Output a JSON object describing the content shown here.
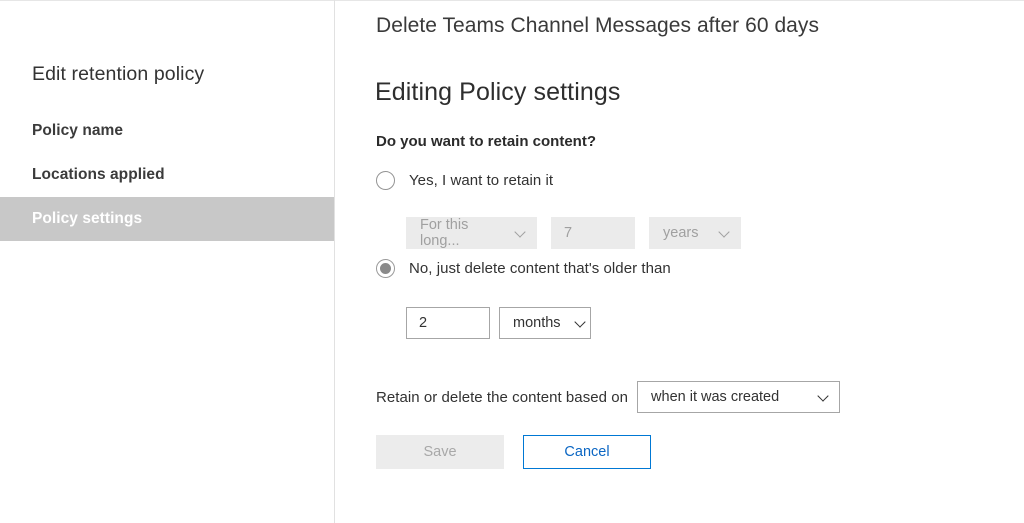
{
  "sidebar": {
    "title": "Edit retention policy",
    "items": [
      {
        "label": "Policy name",
        "selected": false
      },
      {
        "label": "Locations applied",
        "selected": false
      },
      {
        "label": "Policy settings",
        "selected": true
      }
    ]
  },
  "main": {
    "policy_name": "Delete Teams Channel Messages after 60 days",
    "page_title": "Editing Policy settings",
    "question_label": "Do you want to retain content?",
    "options": {
      "retain": {
        "label": "Yes, I want to retain it",
        "selected": false,
        "duration_type": "For this long...",
        "duration_value": "7",
        "duration_unit": "years"
      },
      "delete": {
        "label": "No, just delete content that's older than",
        "selected": true,
        "duration_value": "2",
        "duration_unit": "months"
      }
    },
    "based_on": {
      "label": "Retain or delete the content based on",
      "value": "when it was created"
    },
    "buttons": {
      "save": "Save",
      "cancel": "Cancel"
    }
  },
  "colors": {
    "accent": "#0078d4",
    "accent_text": "#0b66c3",
    "selected_nav_bg": "#c8c8c8",
    "disabled_bg": "#ebebeb",
    "disabled_text": "#a0a0a0",
    "border": "#a6a6a6"
  },
  "icons": {
    "chevron_down": "chevron-down-icon",
    "radio_unselected": "radio-unselected-icon",
    "radio_selected": "radio-selected-icon"
  }
}
